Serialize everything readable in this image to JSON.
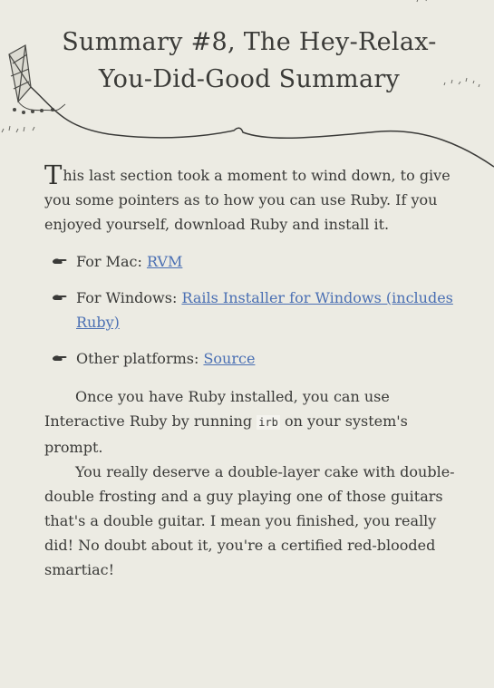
{
  "title": {
    "line1": "Summary #8, The Hey-Relax-",
    "line2": "You-Did-Good Summary"
  },
  "intro": {
    "dropcap": "T",
    "text": "his last section took a moment to wind down, to give you some pointers as to how you can use Ruby. If you enjoyed yourself, download Ruby and install it."
  },
  "links": [
    {
      "label": "For Mac: ",
      "link_text": "RVM"
    },
    {
      "label": "For Windows: ",
      "link_text": "Rails Installer for Windows (includes Ruby)"
    },
    {
      "label": "Other platforms: ",
      "link_text": "Source"
    }
  ],
  "paragraph1": {
    "before": "Once you have Ruby installed, you can use Interactive Ruby by running ",
    "code": "irb",
    "after": " on your system's prompt."
  },
  "paragraph2": {
    "text": "You really deserve a double-layer cake with double-double frosting and a guy playing one of those guitars that's a double guitar. I mean you finished, you really did! No doubt about it, you're a certified red-blooded smartiac!"
  },
  "colors": {
    "background": "#ecebe3",
    "text": "#3a3a38",
    "link": "#4a6fb3"
  },
  "icons": {
    "bullet": "pointing-hand-icon",
    "kite": "kite-illustration-icon"
  }
}
